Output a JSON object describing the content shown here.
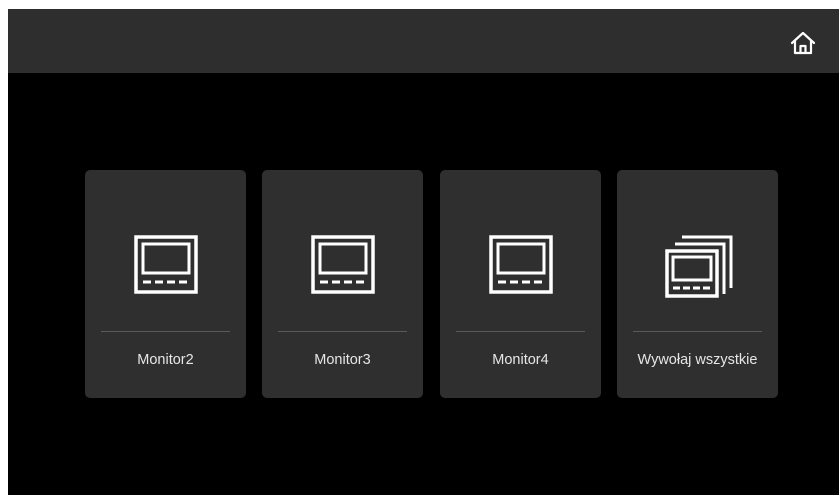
{
  "header": {
    "home_icon": "home-icon"
  },
  "tiles": [
    {
      "label": "Monitor2",
      "icon": "monitor-icon"
    },
    {
      "label": "Monitor3",
      "icon": "monitor-icon"
    },
    {
      "label": "Monitor4",
      "icon": "monitor-icon"
    },
    {
      "label": "Wywołaj wszystkie",
      "icon": "monitors-stack-icon"
    }
  ],
  "colors": {
    "background": "#000000",
    "topbar": "#2e2e2e",
    "tile": "#2f2f2f",
    "icon": "#ffffff",
    "text": "#e6e6e6"
  }
}
